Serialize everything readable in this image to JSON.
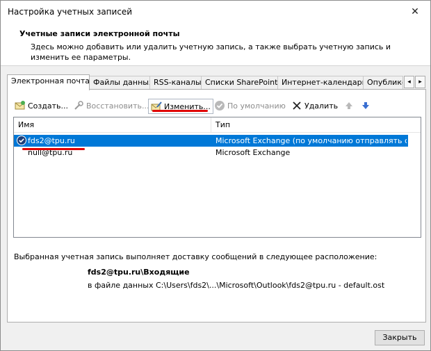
{
  "window": {
    "title": "Настройка учетных записей",
    "close_glyph": "✕"
  },
  "header": {
    "title": "Учетные записи электронной почты",
    "description": "Здесь можно добавить или удалить учетную запись, а также выбрать учетную запись и изменить ее параметры."
  },
  "tabs": [
    {
      "label": "Электронная почта",
      "active": true
    },
    {
      "label": "Файлы данных"
    },
    {
      "label": "RSS-каналы"
    },
    {
      "label": "Списки SharePoint"
    },
    {
      "label": "Интернет-календари"
    },
    {
      "label": "Опубликованные календари"
    }
  ],
  "tab_scroll": {
    "left": "◂",
    "right": "▸"
  },
  "toolbar": {
    "create": "Создать...",
    "restore": "Восстановить...",
    "change": "Изменить...",
    "default": "По умолчанию",
    "delete": "Удалить",
    "up_icon": "arrow-up-icon",
    "down_icon": "arrow-down-icon"
  },
  "accounts_list": {
    "columns": {
      "name": "Имя",
      "type": "Тип"
    },
    "rows": [
      {
        "name": "fds2@tpu.ru",
        "type": "Microsoft Exchange (по умолчанию отправлять с ...",
        "selected": true,
        "default": true
      },
      {
        "name": "null@tpu.ru",
        "type": "Microsoft Exchange",
        "selected": false,
        "default": false
      }
    ]
  },
  "delivery": {
    "label": "Выбранная учетная запись выполняет доставку сообщений в следующее расположение:",
    "folder": "fds2@tpu.ru\\Входящие",
    "file": "в файле данных C:\\Users\\fds2\\...\\Microsoft\\Outlook\\fds2@tpu.ru - default.ost"
  },
  "footer": {
    "close_label": "Закрыть"
  },
  "colors": {
    "selection": "#0078d7",
    "annotation": "#e00000"
  }
}
